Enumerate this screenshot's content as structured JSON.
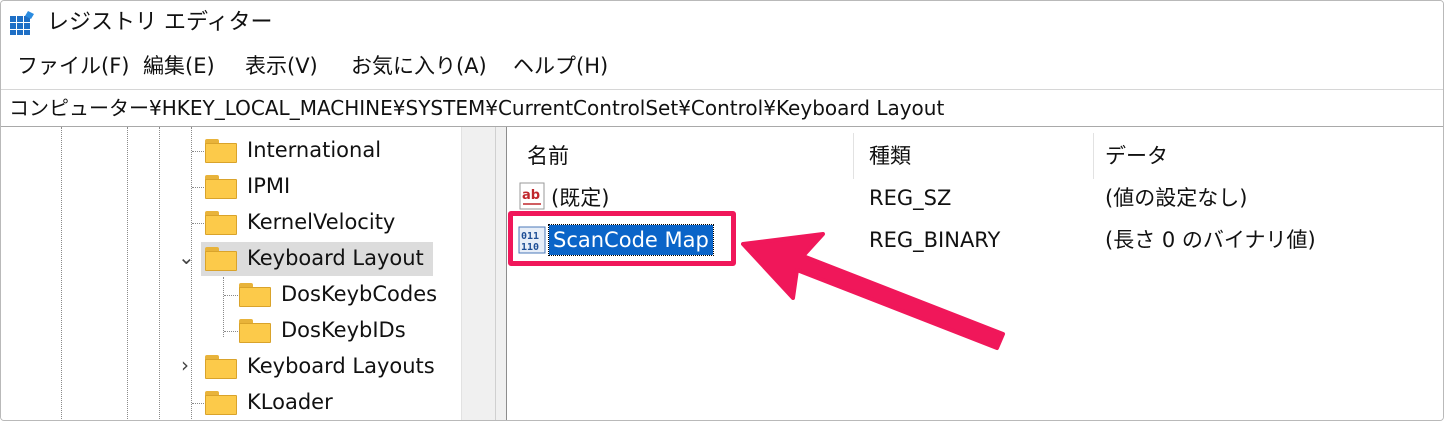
{
  "window": {
    "title": "レジストリ エディター",
    "icon": "registry-editor-icon"
  },
  "menu": [
    {
      "label": "ファイル(F)"
    },
    {
      "label": "編集(E)"
    },
    {
      "label": "表示(V)"
    },
    {
      "label": "お気に入り(A)"
    },
    {
      "label": "ヘルプ(H)"
    }
  ],
  "address": {
    "path": "コンピューター¥HKEY_LOCAL_MACHINE¥SYSTEM¥CurrentControlSet¥Control¥Keyboard Layout"
  },
  "tree": {
    "nodes": [
      {
        "label": "International",
        "state": "none"
      },
      {
        "label": "IPMI",
        "state": "none"
      },
      {
        "label": "KernelVelocity",
        "state": "none"
      },
      {
        "label": "Keyboard Layout",
        "state": "expanded",
        "selected": true
      },
      {
        "label": "DosKeybCodes",
        "state": "child"
      },
      {
        "label": "DosKeybIDs",
        "state": "child"
      },
      {
        "label": "Keyboard Layouts",
        "state": "collapsed"
      },
      {
        "label": "KLoader",
        "state": "none"
      }
    ],
    "folder_color": "#fcca4a"
  },
  "list": {
    "columns": [
      "名前",
      "種類",
      "データ"
    ],
    "rows": [
      {
        "name": "(既定)",
        "type": "REG_SZ",
        "data": "(値の設定なし)",
        "icon": "string-value-icon"
      },
      {
        "name": "ScanCode Map",
        "type": "REG_BINARY",
        "data": "(長さ 0 のバイナリ値)",
        "icon": "binary-value-icon",
        "selected": true
      }
    ]
  },
  "annotation": {
    "color": "#f0175a",
    "selection_color": "#0a64c8"
  }
}
